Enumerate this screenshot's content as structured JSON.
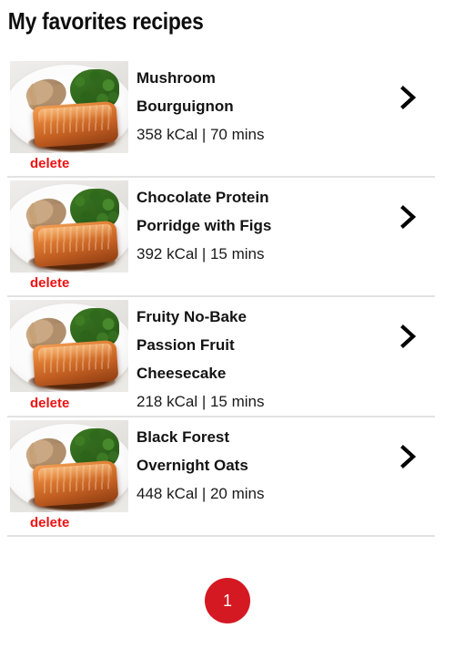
{
  "header": {
    "title": "My favorites recipes"
  },
  "list": {
    "delete_label": "delete",
    "chevron_icon": "chevron-right-icon",
    "thumbnail_icon": "recipe-thumbnail-salmon-plate",
    "items": [
      {
        "name_line1": "Mushroom",
        "name_line2": "Bourguignon",
        "name_line3": "",
        "meta": "358 kCal | 70 mins",
        "calories": "358 kCal",
        "time": "70 mins",
        "delete_label": "delete"
      },
      {
        "name_line1": "Chocolate Protein",
        "name_line2": "Porridge with Figs",
        "name_line3": "",
        "meta": "392 kCal | 15 mins",
        "calories": "392 kCal",
        "time": "15 mins",
        "delete_label": "delete"
      },
      {
        "name_line1": "Fruity No-Bake",
        "name_line2": "Passion Fruit",
        "name_line3": "Cheesecake",
        "meta": "218 kCal | 15 mins",
        "calories": "218 kCal",
        "time": "15 mins",
        "delete_label": "delete"
      },
      {
        "name_line1": "Black Forest",
        "name_line2": "Overnight Oats",
        "name_line3": "",
        "meta": "448 kCal | 20 mins",
        "calories": "448 kCal",
        "time": "20 mins",
        "delete_label": "delete"
      }
    ]
  },
  "pagination": {
    "current_page": "1"
  },
  "colors": {
    "delete_red": "#ee1111",
    "pagination_red": "#d51922",
    "divider_gray": "#e2e2e2",
    "text_black": "#131313"
  }
}
